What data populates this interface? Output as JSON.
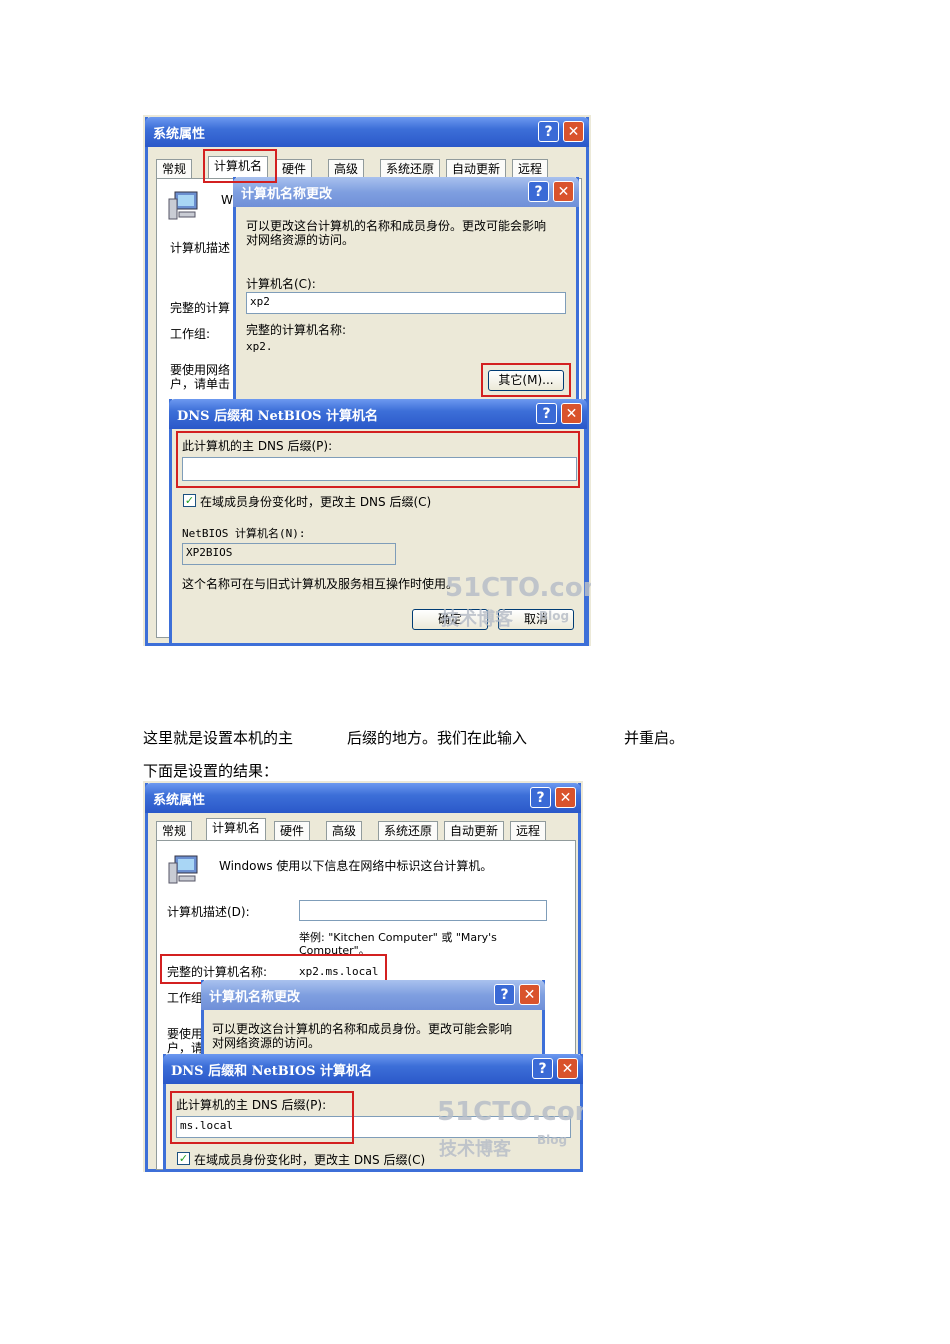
{
  "shot1": {
    "sys_props": {
      "title": "系统属性",
      "tabs": [
        "常规",
        "计算机名",
        "硬件",
        "高级",
        "系统还原",
        "自动更新",
        "远程"
      ],
      "partial_w": "W",
      "partial_desc": "计算机描述",
      "partial_full": "完整的计算",
      "partial_workgroup": "工作组:",
      "partial_note1": "要使用网络",
      "partial_note2": "户，请单击"
    },
    "change_dialog": {
      "title": "计算机名称更改",
      "intro_line1": "可以更改这台计算机的名称和成员身份。更改可能会影响",
      "intro_line2": "对网络资源的访问。",
      "name_label": "计算机名(C):",
      "name_value": "xp2",
      "full_label": "完整的计算机名称:",
      "full_value": "xp2.",
      "other_button": "其它(M)..."
    },
    "dns_dialog": {
      "title": "DNS 后缀和 NetBIOS 计算机名",
      "primary_label": "此计算机的主 DNS 后缀(P):",
      "primary_value": "",
      "checkbox_label": "在域成员身份变化时，更改主 DNS 后缀(C)",
      "netbios_label": "NetBIOS 计算机名(N):",
      "netbios_value": "XP2BIOS",
      "note": "这个名称可在与旧式计算机及服务相互操作时使用。",
      "ok_button": "确定",
      "cancel_button": "取消"
    }
  },
  "text": {
    "p1_a": "这里就是设置本机的主",
    "p1_b": "后缀的地方。我们在此输入",
    "p1_c": "并重启。",
    "p2": "下面是设置的结果："
  },
  "shot2": {
    "sys_props": {
      "title": "系统属性",
      "tabs": [
        "常规",
        "计算机名",
        "硬件",
        "高级",
        "系统还原",
        "自动更新",
        "远程"
      ],
      "info": "Windows 使用以下信息在网络中标识这台计算机。",
      "desc_label": "计算机描述(D):",
      "desc_value": "",
      "example_line1": "举例: \"Kitchen Computer\" 或 \"Mary's",
      "example_line2": "Computer\"。",
      "full_label": "完整的计算机名称:",
      "full_value": "xp2.ms.local",
      "partial_workgroup": "工作组",
      "partial_note1": "要使用",
      "partial_note2": "户，请"
    },
    "change_dialog": {
      "title": "计算机名称更改",
      "intro_line1": "可以更改这台计算机的名称和成员身份。更改可能会影响",
      "intro_line2": "对网络资源的访问。"
    },
    "dns_dialog": {
      "title": "DNS 后缀和 NetBIOS 计算机名",
      "primary_label": "此计算机的主 DNS 后缀(P):",
      "primary_value": "ms.local",
      "checkbox_label": "在域成员身份变化时，更改主 DNS 后缀(C)"
    }
  },
  "watermark": {
    "brand": "51CTO.com",
    "sub": "技术博客",
    "blog": "Blog"
  },
  "icons": {
    "help": "?",
    "close": "✕",
    "check": "✓"
  }
}
